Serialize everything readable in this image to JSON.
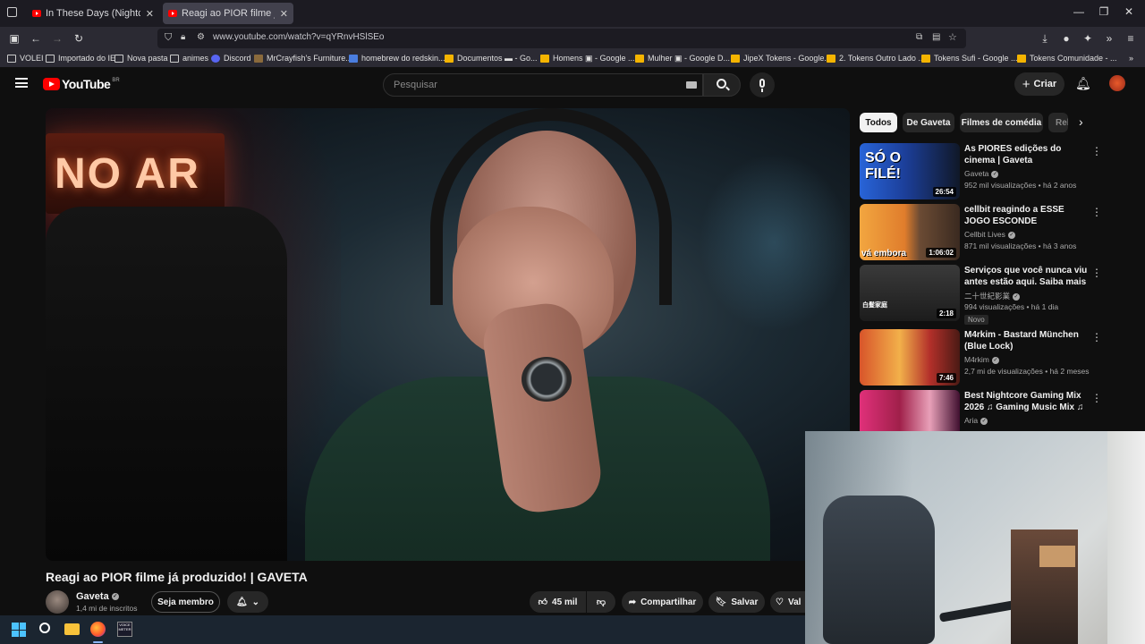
{
  "browser": {
    "tabs": [
      {
        "title": "In These Days (Nightcore Mix) -",
        "active": false
      },
      {
        "title": "Reagi ao PIOR filme já produzid",
        "active": true
      }
    ],
    "url": "www.youtube.com/watch?v=qYRnvHSlSEo",
    "bookmarks": [
      "VOLEI",
      "Importado do IE",
      "Nova pasta",
      "animes",
      "Discord",
      "MrCrayfish's Furniture...",
      "homebrew do redskin...",
      "Documentos ▬ - Go...",
      "Homens ▣ - Google ...",
      "Mulher ▣ - Google D...",
      "JipeX Tokens - Google...",
      "2. Tokens Outro Lado ...",
      "Tokens Sufi - Google ...",
      "Tokens Comunidade - ..."
    ]
  },
  "youtube": {
    "logo_text": "YouTube",
    "region": "BR",
    "search_placeholder": "Pesquisar",
    "create_label": "Criar",
    "video": {
      "title": "Reagi ao PIOR filme já produzido! | GAVETA",
      "overlay_sign": "NO AR"
    },
    "channel": {
      "name": "Gaveta",
      "subscribers": "1,4 mi de inscritos",
      "member_button": "Seja membro"
    },
    "actions": {
      "likes": "45 mil",
      "share": "Compartilhar",
      "save": "Salvar",
      "thanks": "Val"
    },
    "chips": [
      "Todos",
      "De Gaveta",
      "Filmes de comédia",
      "Rel"
    ],
    "recommendations": [
      {
        "title": "As PIORES edições do cinema | Gaveta",
        "channel": "Gaveta",
        "verified": true,
        "meta": "952 mil visualizações • há 2 anos",
        "duration": "26:54",
        "thumb_text": "SÓ O FILÉ!",
        "badge": ""
      },
      {
        "title": "cellbit reagindo a ESSE JOGO ESCONDE SEGREDOS QUE NÃ...",
        "channel": "Cellbit Lives",
        "verified": true,
        "meta": "871 mil visualizações • há 3 anos",
        "duration": "1:06:02",
        "thumb_text": "vá embora",
        "badge": ""
      },
      {
        "title": "Serviços que você nunca viu antes estão aqui. Saiba mais ...",
        "channel": "二十世紀影業",
        "verified": true,
        "meta": "994 visualizações • há 1 dia",
        "duration": "2:18",
        "thumb_text": "白髮家庭",
        "badge": "Novo"
      },
      {
        "title": "M4rkim - Bastard München (Blue Lock)",
        "channel": "M4rkim",
        "verified": true,
        "meta": "2,7 mi de visualizações • há 2 meses",
        "duration": "7:46",
        "thumb_text": "",
        "badge": ""
      },
      {
        "title": "Best Nightcore Gaming Mix 2026 ♫ Gaming Music Mix ♫ ...",
        "channel": "Aria",
        "verified": true,
        "meta": "",
        "duration": "",
        "thumb_text": "",
        "badge": ""
      }
    ]
  },
  "taskbar": {
    "app_badge": "VOICE METER"
  }
}
